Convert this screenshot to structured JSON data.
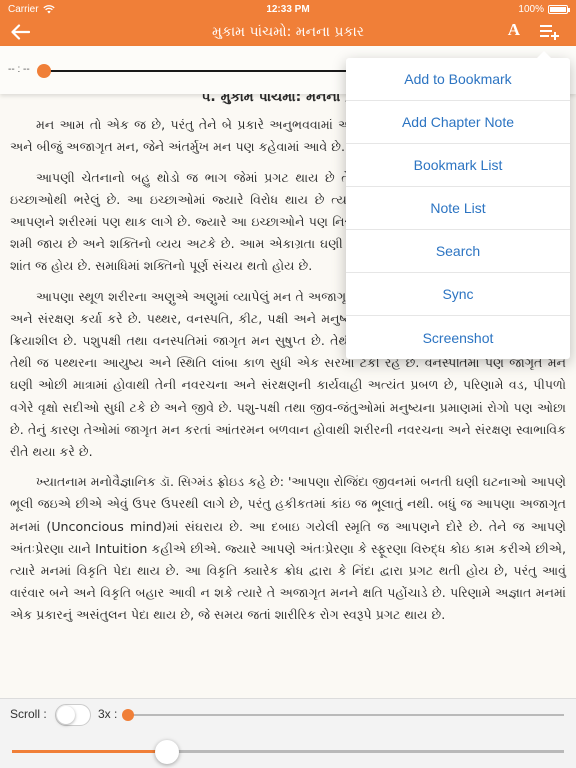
{
  "status_bar": {
    "carrier": "Carrier",
    "time": "12:33 PM",
    "battery": "100%",
    "battery_level": 1.0,
    "wifi_icon": "wifi-icon",
    "battery_icon": "battery-icon"
  },
  "header": {
    "title": "મુકામ પાંચમો: મનના પ્રકાર",
    "back_icon": "back-arrow-icon",
    "font_label": "A",
    "menu_icon": "menu-add-icon",
    "accent_color": "#f07f38"
  },
  "audio": {
    "elapsed": "-- : --",
    "progress": 0.0
  },
  "menu": {
    "items": [
      "Add to Bookmark",
      "Add Chapter Note",
      "Bookmark List",
      "Note List",
      "Search",
      "Sync",
      "Screenshot"
    ]
  },
  "content": {
    "heading": "૫. મુકામ પાંચમો: મનના પ્રકાર",
    "paragraphs": [
      "મન આમ તો એક જ છે, પરંતુ તેને બે પ્રકારે અનુભવવામાં આવે છે. બહિર્મુખ મન પણ કહેવામાં આવે છે અને બીજું અજાગૃત મન, જેને અંતર્મુખ મન પણ કહેવામાં આવે છે.",
      "આપણી ચેતનાનો બહુ થોડો જ ભાગ જેમાં પ્રગટ થાય છે તે જાગૃત મન છે. આ મન અનેક પ્રકારની ઇચ્છાઓથી ભરેલું છે. આ ઇચ્છાઓમાં જ્યારે વિરોધ થાય છે ત્યારે મન વિક્ષુબ્ધ બને છે અને તેને પરિણામે આપણને શરીરમાં પણ થાક લાગે છે. જ્યારે આ ઇચ્છાઓને પણ નિરાગ્રતા આવે છે. એકાગ્રતામાં વિચારોનો વિરોધ શમી જાય છે અને શક્તિનો વ્યય અટકે છે. આમ એકાગ્રતા ઘણી શક્તિ બચાવે છે, જ્યારે નિરાગ્રતામાં તો મન શાંત જ હોય છે. સમાધિમાં શક્તિનો પૂર્ણ સંચય થતો હોય છે.",
      "આપણા સ્થૂળ શરીરના અણુએ અણુમાં વ્યાપેલું મન તે અજાગૃત મન છે અને તે આપણા શરીરની નવરચના અને સંરક્ષણ કર્યા કરે છે. પથ્થર, વનસ્પતિ, કીટ, પક્ષી અને મનુષ્યમાં આ આંતરમન એક સરખું વ્યાપ્ત અને ક્રિયાશીલ છે. પશુપક્ષી તથા વનસ્પતિમાં જાગૃત મન સુષુપ્ત છે. તેથી આંતરમનને મોકળું મેદાન મળેલું છે, અને તેથી જ પથ્થરના આયુષ્ય અને સ્થિતિ લાંબા કાળ સુધી એક સરખા ટકી રહે છે. વનસ્પતિમાં પણ જાગૃત મન ઘણી ઓછી માત્રામાં હોવાથી તેની નવરચના અને સંરક્ષણની કાર્યવાહી અત્યંત પ્રબળ છે, પરિણામે વડ, પીપળો વગેરે વૃક્ષો સદીઓ સુધી ટકે છે અને જીવે છે. પશુ-પક્ષી તથા જીવ-જંતુઓમાં મનુષ્યના પ્રમાણમાં રોગો પણ ઓછા છે. તેનું કારણ તેઓમાં જાગૃત મન કરતાં આંતરમન બળવાન હોવાથી શરીરની નવરચના અને સંરક્ષણ સ્વાભાવિક રીતે થયા કરે છે.",
      "ખ્યાતનામ મનોવૈજ્ઞાનિક ડૉ. સિગ્મંડ ફ્રોઇડ કહે છે: 'આપણા રોજિંદા જીવનમાં બનતી ઘણી ઘટનાઓ આપણે ભૂલી જઇએ છીએ એવું ઉપર ઉપરથી લાગે છે, પરંતુ હકીકતમાં કાંઇ જ ભૂલાતું નથી. બધું જ આપણા અજાગૃત મનમાં (Unconcious mind)માં સંઘરાય છે. આ દબાઇ ગયેલી સ્મૃતિ જ આપણને દોરે છે. તેને જ આપણે અંતઃપ્રેરણા યાને Intuition કહીએ છીએ. જ્યારે આપણે અંતઃપ્રેરણા કે સ્ફૂરણા વિરુદ્ધ કોઇ કામ કરીએ છીએ, ત્યારે મનમાં વિકૃતિ પેદા થાય છે. આ વિકૃતિ ક્યારેક ક્રોધ દ્વારા કે નિંદા દ્વારા પ્રગટ થતી હોય છે, પરંતુ આવું વારંવાર બને અને વિકૃતિ બહાર આવી ન શકે ત્યારે તે અજાગૃત મનને ક્ષતિ પહોંચાડે છે. પરિણામે અજ્ઞાત મનમાં એક પ્રકારનું અસંતુલન પેદા થાય છે, જે સમય જતાં શારીરિક રોગ સ્વરૂપે પ્રગટ થાય છે."
    ]
  },
  "bottom": {
    "scroll_label": "Scroll :",
    "scroll_enabled": false,
    "speed_label": "3x :",
    "speed_value": 0.0,
    "page_progress": 0.28
  }
}
